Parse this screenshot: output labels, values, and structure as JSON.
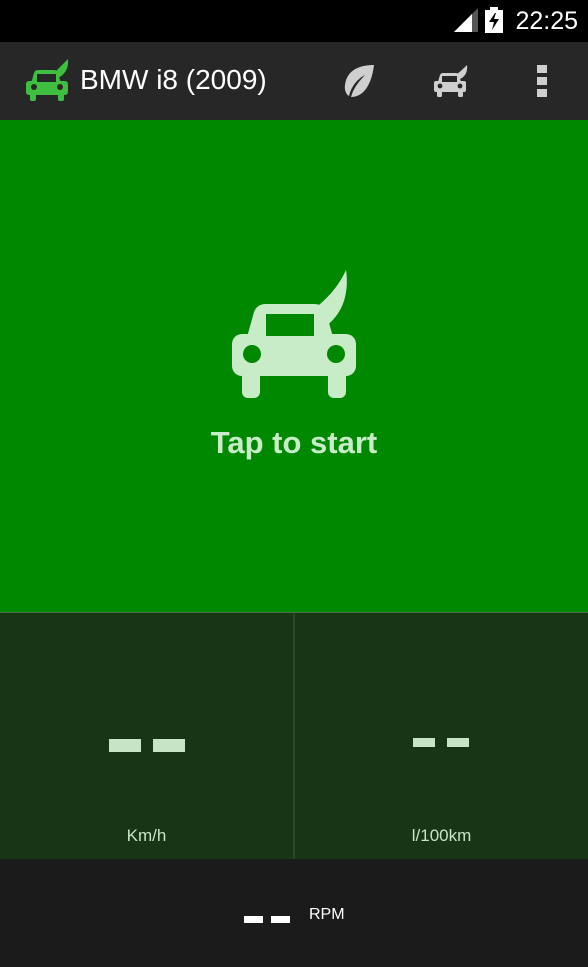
{
  "status_bar": {
    "time": "22:25",
    "icons": [
      "signal-icon",
      "battery-charging-icon"
    ]
  },
  "action_bar": {
    "title": "BMW i8 (2009)",
    "actions": [
      {
        "name": "eco-leaf-button",
        "icon": "leaf-icon"
      },
      {
        "name": "car-profile-button",
        "icon": "car-leaf-icon"
      },
      {
        "name": "overflow-menu-button",
        "icon": "more-vert-icon"
      }
    ]
  },
  "start": {
    "label": "Tap to start",
    "icon": "car-leaf-icon"
  },
  "gauges": {
    "speed": {
      "value": "--",
      "unit": "Km/h"
    },
    "fuel": {
      "value": "--",
      "unit": "l/100km"
    },
    "rpm": {
      "value": "--",
      "unit": "RPM"
    }
  },
  "colors": {
    "primary_green": "#008800",
    "gauge_bg": "#163615",
    "action_bar_bg": "#272727",
    "rpm_bg": "#1b1b1b",
    "brand_icon_green": "#3fbf3f"
  }
}
